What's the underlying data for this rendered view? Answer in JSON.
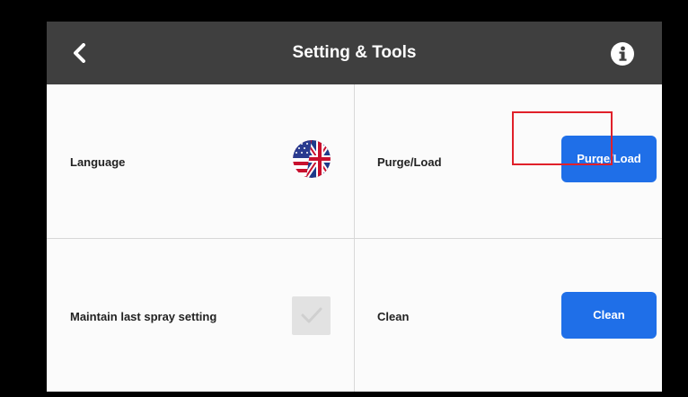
{
  "header": {
    "title": "Setting & Tools",
    "back_icon": "chevron-left-icon",
    "info_icon": "info-icon"
  },
  "settings": {
    "language": {
      "label": "Language",
      "flag_icon": "us-uk-flag-icon"
    },
    "purge_load": {
      "label": "Purge/Load",
      "button_label": "Purge/Load"
    },
    "maintain_spray": {
      "label": "Maintain last spray setting",
      "checked": true
    },
    "clean": {
      "label": "Clean",
      "button_label": "Clean"
    }
  },
  "colors": {
    "header_bg": "#3f3f3f",
    "accent": "#1f6fe8",
    "highlight": "#e0202a"
  }
}
